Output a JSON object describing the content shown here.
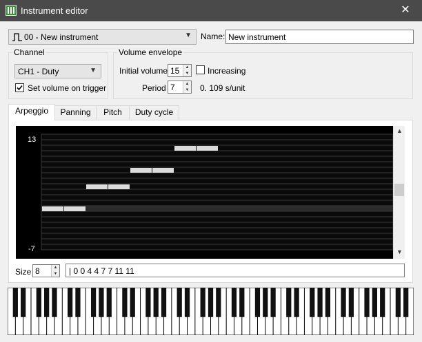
{
  "window": {
    "title": "Instrument editor",
    "close_glyph": "✕"
  },
  "instrument": {
    "selected": "00 - New instrument",
    "name_label": "Name:",
    "name_value": "New instrument"
  },
  "channel": {
    "legend": "Channel",
    "selected": "CH1 - Duty",
    "set_volume_label": "Set volume on trigger",
    "set_volume_checked": true
  },
  "volume": {
    "legend": "Volume envelope",
    "initial_label": "Initial volume",
    "initial_value": "15",
    "increasing_label": "Increasing",
    "increasing_checked": false,
    "period_label": "Period",
    "period_value": "7",
    "rate": "0. 109 s/unit"
  },
  "tabs": [
    "Arpeggio",
    "Panning",
    "Pitch",
    "Duty cycle"
  ],
  "arpeggio": {
    "max_label": "13",
    "min_label": "-7",
    "size_label": "Size",
    "size_value": "8",
    "sequence": "| 0 0 4 4 7 7 11 11",
    "values": [
      0,
      0,
      4,
      4,
      7,
      7,
      11,
      11
    ],
    "range": [
      -7,
      13
    ]
  },
  "icons": {
    "app": "piano-icon",
    "close": "close-icon",
    "wave": "pulse-wave-icon"
  }
}
